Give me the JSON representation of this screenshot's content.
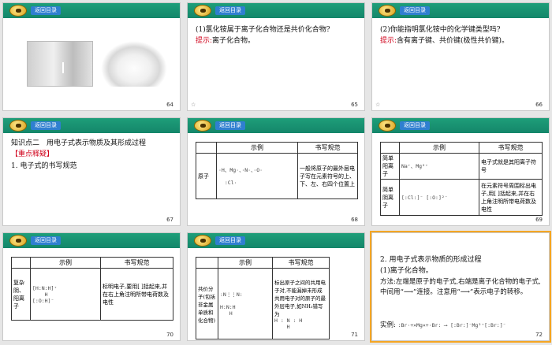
{
  "back_label": "返回目录",
  "slides": {
    "s64": {
      "num": "64"
    },
    "s65": {
      "num": "65",
      "star": "☆",
      "q": "(1)氯化铵属于离子化合物还是共价化合物?",
      "hint": "提示:",
      "ans": "离子化合物。"
    },
    "s66": {
      "num": "66",
      "star": "☆",
      "q": "(2)你能指明氯化铵中的化学键类型吗?",
      "hint": "提示:",
      "ans": "含有离子键、共价键(极性共价键)。"
    },
    "s67": {
      "num": "67",
      "title": "知识点二　用电子式表示物质及其形成过程",
      "tag": "【重点释疑】",
      "item": "1. 电子式的书写规范"
    },
    "s68": {
      "num": "68",
      "col1": "示例",
      "col2": "书写规范",
      "row": "原子",
      "example": "·H、Mg·、·N·、·O·\n\n  :Cl·",
      "rule": "一般将原子的最外层电子写在元素符号的上、下、左、右四个位置上"
    },
    "s69": {
      "num": "69",
      "col1": "示例",
      "col2": "书写规范",
      "row1": "简单阳离子",
      "ex1": "Na⁺、Mg²⁺",
      "rule1": "电子式就是其阳离子符号",
      "row2": "简单阴离子",
      "ex2": "[:Cl:]⁻ [:O:]²⁻",
      "rule2": "在元素符号周围标出电子,用[ ]括起来,并在右上角注明所带电荷数及电性"
    },
    "s70": {
      "num": "70",
      "col1": "示例",
      "col2": "书写规范",
      "row": "复杂阴、阳离子",
      "example": "[H:N:H]⁺\n    H\n[:O:H]⁻",
      "rule": "标明电子,要用[ ]括起来,并在右上角注明所带电荷数及电性"
    },
    "s71": {
      "num": "71",
      "col1": "示例",
      "col2": "书写规范",
      "row": "共价分子(包括非金属单质和化合物)",
      "example": ":N⋮⋮N:\n\nH:N:H\n   H",
      "rule": "标出原子之间的共用电子对,不能漏掉未形成共用电子对的原子的最外层电子,如NH₃错写为",
      "rule_ex": "H : N : H\n    H"
    },
    "s72": {
      "num": "72",
      "title": "2. 用电子式表示物质的形成过程",
      "sub": "(1)离子化合物。",
      "method": "方法:左端是原子的电子式,右端是离子化合物的电子式,中间用“⟶”连接。注意用“⟶”表示电子的转移。",
      "example_label": "实例:",
      "example": ":Br·+×Mg×+·Br: ⟶ [:Br:]⁻Mg²⁺[:Br:]⁻"
    }
  },
  "colors": {
    "header": "#169072",
    "hint": "#d0021b",
    "back_button": "#2f7fd0"
  }
}
